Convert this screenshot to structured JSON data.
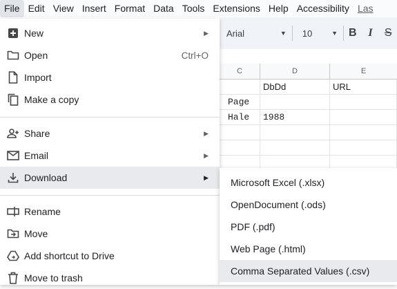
{
  "menubar": {
    "items": [
      "File",
      "Edit",
      "View",
      "Insert",
      "Format",
      "Data",
      "Tools",
      "Extensions",
      "Help",
      "Accessibility",
      "Las"
    ]
  },
  "toolbar": {
    "font": "Arial",
    "size": "10",
    "bold": "B",
    "italic": "I",
    "strike": "S"
  },
  "grid": {
    "columns": [
      "C",
      "D",
      "E"
    ],
    "cells": {
      "d1": "DbDd",
      "e1": "URL",
      "c2": "Page",
      "c3": "Hale",
      "d3": "1988"
    }
  },
  "file_menu": {
    "items": [
      {
        "label": "New",
        "icon": "plus-box-icon",
        "submenu": true
      },
      {
        "label": "Open",
        "icon": "folder-icon",
        "shortcut": "Ctrl+O"
      },
      {
        "label": "Import",
        "icon": "file-icon"
      },
      {
        "label": "Make a copy",
        "icon": "copy-icon"
      },
      {
        "label": "Share",
        "icon": "person-add-icon",
        "submenu": true
      },
      {
        "label": "Email",
        "icon": "mail-icon",
        "submenu": true
      },
      {
        "label": "Download",
        "icon": "download-icon",
        "submenu": true,
        "highlighted": true
      },
      {
        "label": "Rename",
        "icon": "rename-icon"
      },
      {
        "label": "Move",
        "icon": "move-icon"
      },
      {
        "label": "Add shortcut to Drive",
        "icon": "drive-shortcut-icon"
      },
      {
        "label": "Move to trash",
        "icon": "trash-icon"
      }
    ]
  },
  "download_submenu": {
    "items": [
      "Microsoft Excel (.xlsx)",
      "OpenDocument (.ods)",
      "PDF (.pdf)",
      "Web Page (.html)",
      "Comma Separated Values (.csv)"
    ],
    "highlighted_index": 4
  }
}
